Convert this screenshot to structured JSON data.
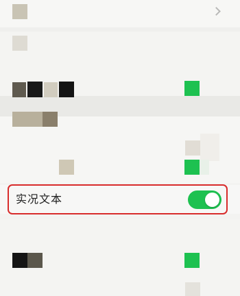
{
  "live_text_row": {
    "label": "实况文本",
    "toggle_state": "on"
  },
  "colors": {
    "accent_green": "#1dc150",
    "highlight_red": "#d82b2b"
  },
  "icons": [
    "chevron-right-icon"
  ]
}
